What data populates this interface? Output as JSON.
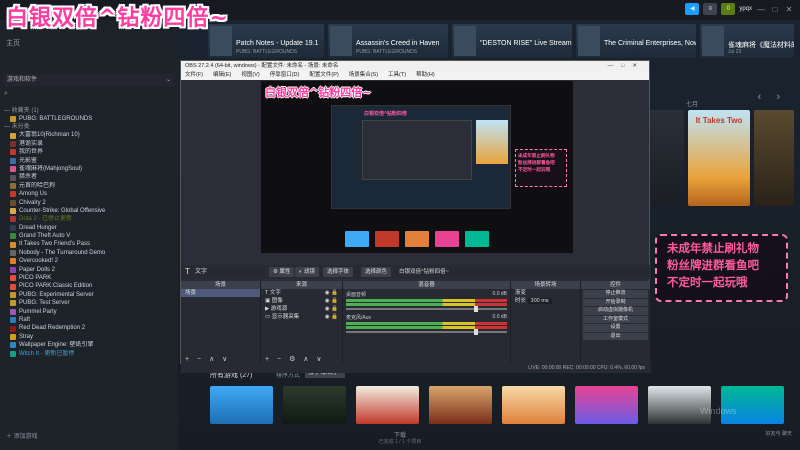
{
  "overlay_title": "白银双倍^钻粉四倍~",
  "steam": {
    "topbar": {
      "buttons": [
        "◀",
        "≡",
        "0"
      ],
      "username": "ypqx",
      "winctl": [
        "—",
        "□",
        "✕"
      ]
    },
    "sidebar": {
      "home": "主页",
      "filter": "游戏和软件",
      "sections": {
        "favorites": "— 收藏夹 (1)",
        "uncategorized": "— 未分类"
      },
      "favorites": [
        "PUBG: BATTLEGROUNDS"
      ],
      "games": [
        {
          "name": "大富翁10(Richman 10)",
          "style": "",
          "color": "#d6a23c"
        },
        {
          "name": "港诡实录",
          "style": "",
          "color": "#7a3030"
        },
        {
          "name": "我的世界",
          "style": "",
          "color": "#c0392b"
        },
        {
          "name": "光影鉴",
          "style": "",
          "color": "#3c6ea5"
        },
        {
          "name": "雀魂麻将(MahjongSoul)",
          "style": "",
          "color": "#d35a8a"
        },
        {
          "name": "猎杀者",
          "style": "",
          "color": "#555"
        },
        {
          "name": "元首的哈巴狗",
          "style": "",
          "color": "#8a6d3b"
        },
        {
          "name": "Among Us",
          "style": "",
          "color": "#c0392b"
        },
        {
          "name": "Chivalry 2",
          "style": "",
          "color": "#6b4d2a"
        },
        {
          "name": "Counter-Strike: Global Offensive",
          "style": "",
          "color": "#e0a64a"
        },
        {
          "name": "Dota 2 - 已停止更新",
          "style": "dim",
          "color": "#a33"
        },
        {
          "name": "Dread Hunger",
          "style": "",
          "color": "#2c3e50"
        },
        {
          "name": "Grand Theft Auto V",
          "style": "",
          "color": "#3b8a3b"
        },
        {
          "name": "It Takes Two Friend's Pass",
          "style": "",
          "color": "#d98c2b"
        },
        {
          "name": "Nobody - The Turnaround Demo",
          "style": "",
          "color": "#666"
        },
        {
          "name": "Overcooked! 2",
          "style": "",
          "color": "#e67e22"
        },
        {
          "name": "Paper Dolls 2",
          "style": "",
          "color": "#8e44ad"
        },
        {
          "name": "PICO PARK",
          "style": "",
          "color": "#e74c3c"
        },
        {
          "name": "PICO PARK:Classic Edition",
          "style": "",
          "color": "#e74c3c"
        },
        {
          "name": "PUBG: Experimental Server",
          "style": "",
          "color": "#c49b2a"
        },
        {
          "name": "PUBG: Test Server",
          "style": "",
          "color": "#c49b2a"
        },
        {
          "name": "Pummel Party",
          "style": "",
          "color": "#9b59b6"
        },
        {
          "name": "Raft",
          "style": "",
          "color": "#2980b9"
        },
        {
          "name": "Red Dead Redemption 2",
          "style": "",
          "color": "#8b1a1a"
        },
        {
          "name": "Stray",
          "style": "",
          "color": "#d4a017"
        },
        {
          "name": "Wallpaper Engine: 壁纸引擎",
          "style": "",
          "color": "#2e86c1"
        },
        {
          "name": "Witch It - 更新已暂停",
          "style": "upd",
          "color": "#16a085"
        }
      ],
      "add_game": "添加游戏"
    },
    "news": [
      {
        "title": "Patch Notes - Update 19.1",
        "sub": "PUBG: BATTLEGROUNDS"
      },
      {
        "title": "Assassin's Creed in Haven",
        "sub": "PUBG: BATTLEGROUNDS"
      },
      {
        "title": "\"DESTON RISE\" Live Streaming Event with Neymar Jr.",
        "sub": ""
      },
      {
        "title": "The Criminal Enterprises, Now Available",
        "sub": ""
      },
      {
        "title": "雀魂麻将《魔法材料的收集》",
        "sub": "Jul 23"
      }
    ],
    "recent_label": "七月",
    "recent_cover_text": "It Takes Two",
    "all_games": "所有游戏 (27)",
    "sort_label": "排序方式",
    "sort_value": "按字母顺序",
    "download": {
      "label": "下载",
      "sub": "已完成 1 / 1 个项目"
    },
    "friends": "好友与\n聊天",
    "watermark": "Windows"
  },
  "sticker": [
    "未成年禁止刷礼物",
    "粉丝牌进群看鱼吧",
    "不定时一起玩哦"
  ],
  "obs": {
    "title": "OBS 27.2.4 (64-bit, windows) - 配置文件: 未命名 - 场景: 未命名",
    "winctl": [
      "—",
      "□",
      "✕"
    ],
    "menu": [
      "文件(F)",
      "编辑(E)",
      "视图(V)",
      "停靠窗口(D)",
      "配置文件(P)",
      "场景集合(S)",
      "工具(T)",
      "帮助(H)"
    ],
    "preview_title": "白银双倍^钻粉四倍~",
    "preview_inner_title": "白银双倍^钻粉四倍",
    "preview_sticker": [
      "未成年禁止刷礼物",
      "粉丝牌进群看鱼吧",
      "不定时一起玩哦"
    ],
    "source_bar": {
      "selected": "文字",
      "tabs": [
        "属性",
        "滤镜",
        "选择字体",
        "选择颜色",
        "白银双倍^钻粉四倍~"
      ]
    },
    "scenes": {
      "header": "场景",
      "items": [
        "场景"
      ]
    },
    "sources": {
      "header": "来源",
      "items": [
        "文字",
        "图像",
        "游戏源",
        "显示器采集"
      ]
    },
    "mixer": {
      "header": "混音器",
      "channels": [
        {
          "name": "桌面音频",
          "db": "0.0 dB"
        },
        {
          "name": "麦克风/Aux",
          "db": "0.0 dB"
        }
      ]
    },
    "transitions": {
      "header": "场景转场",
      "type": "渐变",
      "duration_label": "时长",
      "duration": "300 ms"
    },
    "controls": {
      "header": "控件",
      "buttons": [
        "停止推流",
        "开始录制",
        "启动虚拟摄像机",
        "工作室模式",
        "设置",
        "退出"
      ]
    },
    "status": "LIVE: 00:00:00    REC: 00:00:00    CPU: 0.4%, 60.00 fps"
  }
}
